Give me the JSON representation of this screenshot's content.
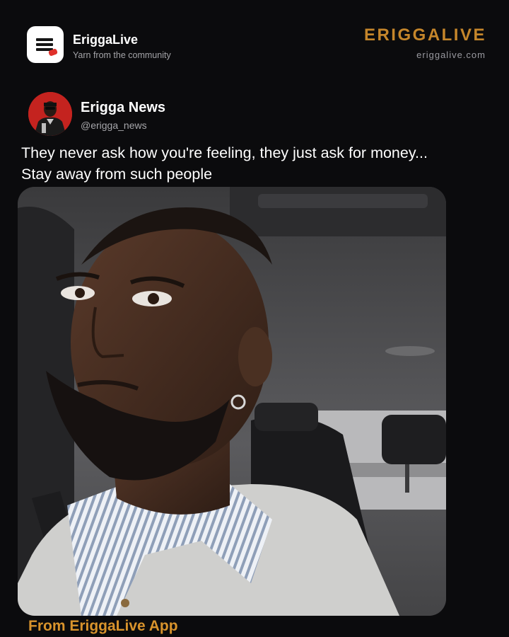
{
  "header": {
    "app_icon": "eriggalive-logo-icon",
    "app_name": "EriggaLive",
    "tagline": "Yarn from the community",
    "brand_name": "ERIGGALIVE",
    "brand_site": "eriggalive.com",
    "brand_color": "#c5862b"
  },
  "post": {
    "author_name": "Erigga News",
    "author_handle": "@erigga_news",
    "avatar_icon": "profile-photo",
    "avatar_color": "#c4231f",
    "text_line1": "They never ask how you're feeling, they just ask for money...",
    "text_line2": "Stay away from such people",
    "media_icon": "photo-man-in-car"
  },
  "footer": {
    "label": "From EriggaLive App",
    "color": "#d8932c"
  }
}
